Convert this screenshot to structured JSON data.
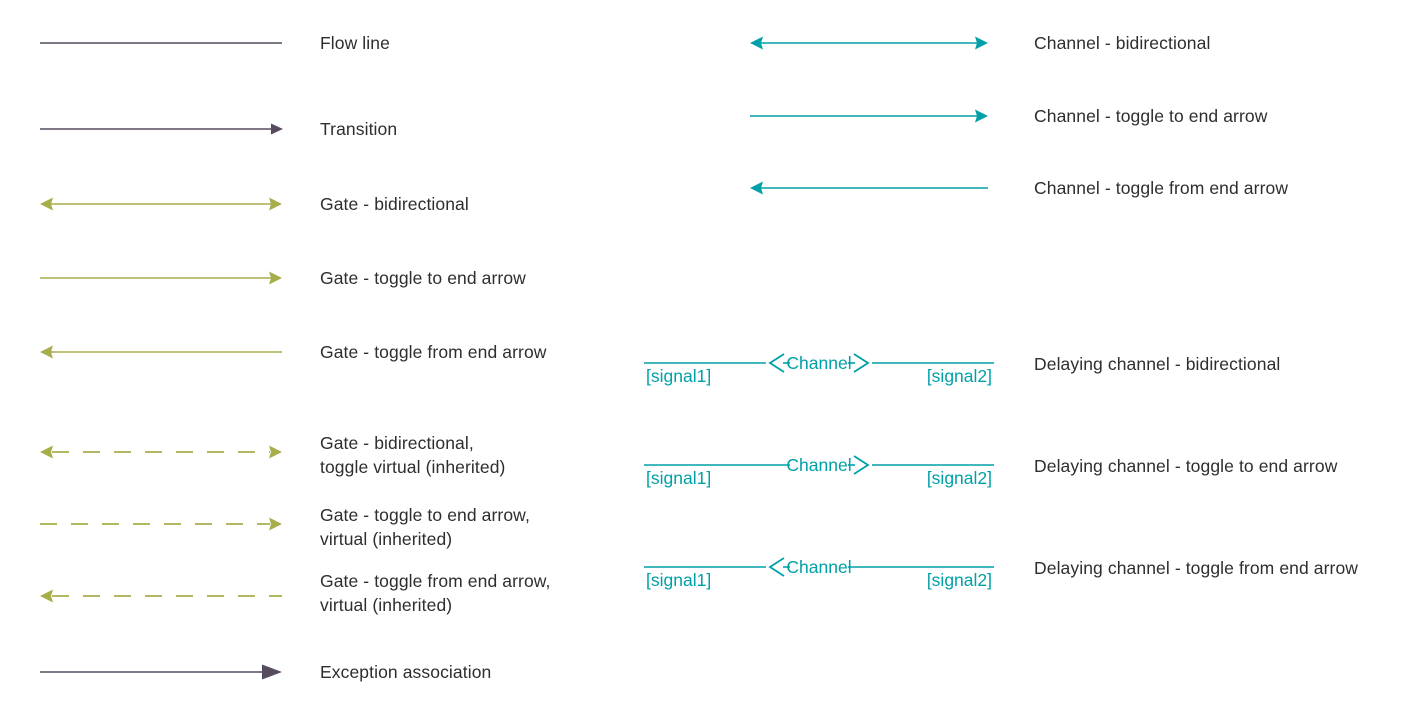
{
  "diagram": {
    "title": "Connector symbols legend",
    "background": "#ffffff",
    "colors": {
      "flow_line": "#574c5e",
      "transition": "#574c5e",
      "exception": "#574c5e",
      "gate": "#a8ad4b",
      "channel": "#00a0a8",
      "delaying_channel": "#00a0a8",
      "label_text": "#2e2e2e"
    }
  },
  "left_column": {
    "items": [
      {
        "id": "flow-line",
        "label": "Flow line",
        "style": "solid",
        "color": "#574c5e",
        "start_arrow": "none",
        "end_arrow": "none"
      },
      {
        "id": "transition",
        "label": "Transition",
        "style": "solid",
        "color": "#574c5e",
        "start_arrow": "none",
        "end_arrow": "filled-small"
      },
      {
        "id": "gate-bidirectional",
        "label": "Gate - bidirectional",
        "style": "solid",
        "color": "#a8ad4b",
        "start_arrow": "filled",
        "end_arrow": "filled"
      },
      {
        "id": "gate-toggle-to-end-arrow",
        "label": "Gate - toggle to end arrow",
        "style": "solid",
        "color": "#a8ad4b",
        "start_arrow": "none",
        "end_arrow": "filled"
      },
      {
        "id": "gate-toggle-from-end-arrow",
        "label": "Gate - toggle from end arrow",
        "style": "solid",
        "color": "#a8ad4b",
        "start_arrow": "filled",
        "end_arrow": "none"
      },
      {
        "id": "gate-bidirectional-virtual",
        "label": "Gate - bidirectional,\ntoggle virtual (inherited)",
        "style": "dashed",
        "color": "#a8ad4b",
        "start_arrow": "filled",
        "end_arrow": "filled"
      },
      {
        "id": "gate-toggle-to-end-arrow-virtual",
        "label": "Gate - toggle to end arrow,\nvirtual (inherited)",
        "style": "dashed",
        "color": "#a8ad4b",
        "start_arrow": "none",
        "end_arrow": "filled"
      },
      {
        "id": "gate-toggle-from-end-arrow-virtual",
        "label": "Gate - toggle from end arrow,\nvirtual (inherited)",
        "style": "dashed",
        "color": "#a8ad4b",
        "start_arrow": "filled",
        "end_arrow": "none"
      },
      {
        "id": "exception-association",
        "label": "Exception association",
        "style": "solid",
        "color": "#574c5e",
        "start_arrow": "none",
        "end_arrow": "filled-large"
      }
    ]
  },
  "right_column": {
    "items": [
      {
        "id": "channel-bidirectional",
        "label": "Channel - bidirectional",
        "style": "solid",
        "color": "#00a0a8",
        "start_arrow": "filled",
        "end_arrow": "filled"
      },
      {
        "id": "channel-toggle-to-end-arrow",
        "label": "Channel - toggle to end arrow",
        "style": "solid",
        "color": "#00a0a8",
        "start_arrow": "none",
        "end_arrow": "filled"
      },
      {
        "id": "channel-toggle-from-end-arrow",
        "label": "Channel - toggle from end arrow",
        "style": "solid",
        "color": "#00a0a8",
        "start_arrow": "filled",
        "end_arrow": "none"
      }
    ]
  },
  "delaying_channels": {
    "signal_left": "[signal1]",
    "signal_right": "[signal2]",
    "channel_text": "Channel",
    "items": [
      {
        "id": "delaying-channel-bidirectional",
        "label": "Delaying channel - bidirectional",
        "color": "#00a0a8",
        "left_chevron": true,
        "right_chevron": true
      },
      {
        "id": "delaying-channel-toggle-to-end-arrow",
        "label": "Delaying channel - toggle to end arrow",
        "color": "#00a0a8",
        "left_chevron": false,
        "right_chevron": true
      },
      {
        "id": "delaying-channel-toggle-from-end-arrow",
        "label": "Delaying channel - toggle from end arrow",
        "color": "#00a0a8",
        "left_chevron": true,
        "right_chevron": false
      }
    ]
  }
}
